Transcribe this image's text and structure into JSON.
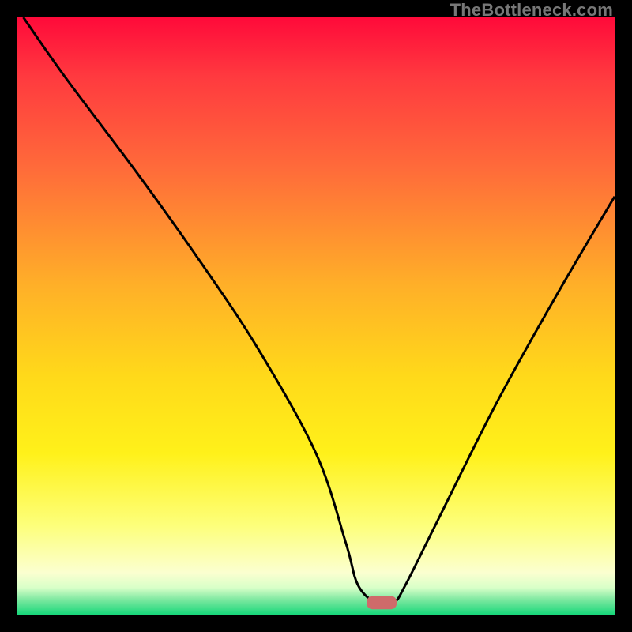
{
  "watermark": "TheBottleneck.com",
  "chart_data": {
    "type": "line",
    "title": "",
    "xlabel": "",
    "ylabel": "",
    "xlim": [
      0,
      100
    ],
    "ylim": [
      0,
      100
    ],
    "grid": false,
    "series": [
      {
        "name": "bottleneck-curve",
        "x": [
          1,
          8,
          20,
          30,
          40,
          50,
          55,
          57,
          60,
          63,
          65,
          70,
          80,
          90,
          100
        ],
        "values": [
          100,
          90,
          74,
          60,
          45,
          27,
          12,
          5,
          2,
          2,
          5,
          15,
          35,
          53,
          70
        ]
      }
    ],
    "marker": {
      "x": 61,
      "y": 2,
      "width": 5,
      "height": 2.2,
      "color": "#cf6a6a"
    },
    "gradient_stops": [
      {
        "offset": 0.0,
        "color": "#ff0a3a"
      },
      {
        "offset": 0.1,
        "color": "#ff3a3f"
      },
      {
        "offset": 0.25,
        "color": "#ff6a3a"
      },
      {
        "offset": 0.45,
        "color": "#ffb028"
      },
      {
        "offset": 0.6,
        "color": "#ffd91a"
      },
      {
        "offset": 0.73,
        "color": "#fff11a"
      },
      {
        "offset": 0.85,
        "color": "#fdff7a"
      },
      {
        "offset": 0.93,
        "color": "#fbffd0"
      },
      {
        "offset": 0.955,
        "color": "#d8ffc8"
      },
      {
        "offset": 0.975,
        "color": "#7de8a0"
      },
      {
        "offset": 1.0,
        "color": "#17d77a"
      }
    ]
  }
}
